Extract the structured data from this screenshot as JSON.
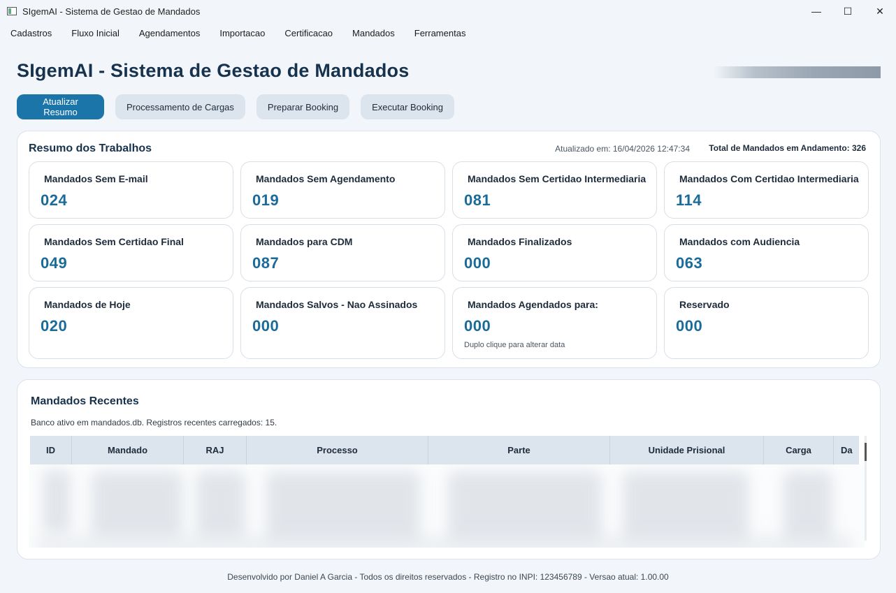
{
  "window": {
    "title": "SIgemAI - Sistema de Gestao de Mandados",
    "min_glyph": "—",
    "max_glyph": "☐",
    "close_glyph": "✕"
  },
  "menu": [
    "Cadastros",
    "Fluxo Inicial",
    "Agendamentos",
    "Importacao",
    "Certificacao",
    "Mandados",
    "Ferramentas"
  ],
  "header": {
    "title": "SIgemAI - Sistema de Gestao de Mandados"
  },
  "actions": [
    "Atualizar Resumo",
    "Processamento de Cargas",
    "Preparar Booking",
    "Executar Booking"
  ],
  "summary": {
    "title": "Resumo dos Trabalhos",
    "updated_at": "Atualizado em: 16/04/2026 12:47:34",
    "total": "Total de Mandados em Andamento: 326",
    "cards": [
      {
        "label": "Mandados Sem E-mail",
        "value": "024"
      },
      {
        "label": "Mandados Sem Agendamento",
        "value": "019"
      },
      {
        "label": "Mandados Sem Certidao Intermediaria",
        "value": "081"
      },
      {
        "label": "Mandados Com Certidao Intermediaria",
        "value": "114"
      },
      {
        "label": "Mandados Sem Certidao Final",
        "value": "049"
      },
      {
        "label": "Mandados para CDM",
        "value": "087"
      },
      {
        "label": "Mandados Finalizados",
        "value": "000"
      },
      {
        "label": "Mandados com Audiencia",
        "value": "063"
      },
      {
        "label": "Mandados de Hoje",
        "value": "020"
      },
      {
        "label": "Mandados Salvos - Nao Assinados",
        "value": "000"
      },
      {
        "label": "Mandados Agendados para:",
        "value": "000",
        "hint": "Duplo clique para alterar data"
      },
      {
        "label": "Reservado",
        "value": "000"
      }
    ]
  },
  "recent": {
    "title": "Mandados Recentes",
    "info": "Banco ativo em mandados.db. Registros recentes carregados: 15.",
    "columns": [
      "ID",
      "Mandado",
      "RAJ",
      "Processo",
      "Parte",
      "Unidade Prisional",
      "Carga",
      "Da"
    ]
  },
  "footer": "Desenvolvido por Daniel A Garcia - Todos os direitos reservados - Registro no INPI: 123456789 - Versao atual: 1.00.00",
  "colors": {
    "primary": "#1b75a9",
    "value": "#1a6b99",
    "heading": "#16324d"
  }
}
